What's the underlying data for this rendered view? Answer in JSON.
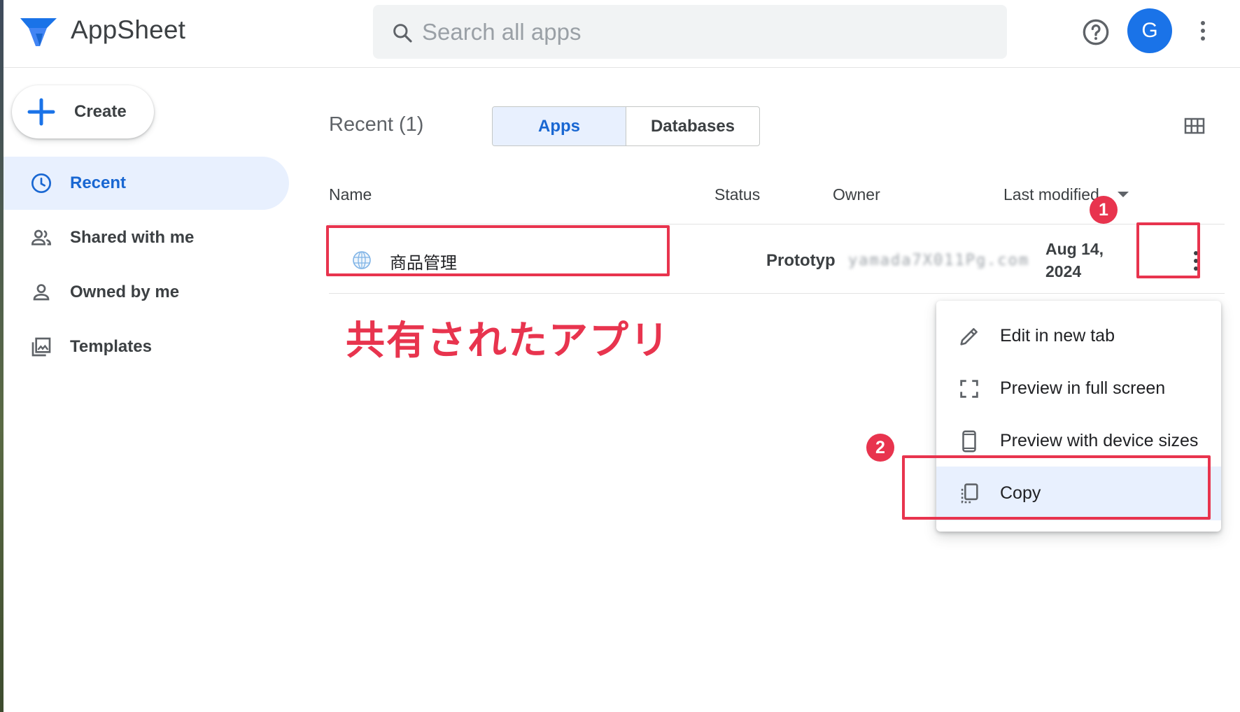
{
  "header": {
    "brand": "AppSheet",
    "search_placeholder": "Search all apps",
    "avatar_letter": "G"
  },
  "sidebar": {
    "create_label": "Create",
    "items": [
      {
        "label": "Recent",
        "icon": "clock-icon",
        "active": true
      },
      {
        "label": "Shared with me",
        "icon": "people-icon",
        "active": false
      },
      {
        "label": "Owned by me",
        "icon": "person-icon",
        "active": false
      },
      {
        "label": "Templates",
        "icon": "image-gallery-icon",
        "active": false
      }
    ]
  },
  "main": {
    "title": "Recent (1)",
    "tabs": [
      {
        "label": "Apps",
        "active": true
      },
      {
        "label": "Databases",
        "active": false
      }
    ],
    "columns": [
      "Name",
      "Status",
      "Owner",
      "Last modified"
    ],
    "rows": [
      {
        "name": "商品管理",
        "status": "Prototyp",
        "owner": "yamada7X011Pg.com",
        "modified": "Aug 14, 2024"
      }
    ]
  },
  "annotations": {
    "note": "共有されたアプリ",
    "step1": "1",
    "step2": "2",
    "color": "#e8344e"
  },
  "menu": {
    "items": [
      {
        "label": "Edit in new tab",
        "icon": "pencil-icon"
      },
      {
        "label": "Preview in full screen",
        "icon": "fullscreen-icon"
      },
      {
        "label": "Preview with device sizes",
        "icon": "phone-icon"
      },
      {
        "label": "Copy",
        "icon": "copy-icon",
        "selected": true
      }
    ]
  },
  "colors": {
    "accent": "#1a73e8",
    "active_bg": "#e8f0fe",
    "annotation": "#e8344e"
  }
}
